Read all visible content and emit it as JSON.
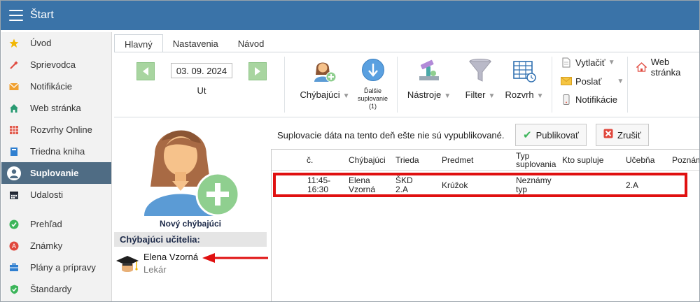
{
  "window": {
    "title": "Štart"
  },
  "sidebar": {
    "items": [
      {
        "label": "Úvod",
        "icon": "star-icon"
      },
      {
        "label": "Sprievodca",
        "icon": "wand-icon"
      },
      {
        "label": "Notifikácie",
        "icon": "envelope-icon"
      },
      {
        "label": "Web stránka",
        "icon": "home-icon"
      },
      {
        "label": "Rozvrhy Online",
        "icon": "calendar-grid-icon"
      },
      {
        "label": "Triedna kniha",
        "icon": "book-icon"
      },
      {
        "label": "Suplovanie",
        "icon": "person-icon",
        "active": true
      },
      {
        "label": "Udalosti",
        "icon": "calendar-icon"
      },
      {
        "label": "Prehľad",
        "icon": "check-circle-icon"
      },
      {
        "label": "Známky",
        "icon": "grade-icon"
      },
      {
        "label": "Plány a prípravy",
        "icon": "briefcase-icon"
      },
      {
        "label": "Štandardy",
        "icon": "shield-check-icon"
      }
    ]
  },
  "tabs": [
    {
      "label": "Hlavný",
      "active": true
    },
    {
      "label": "Nastavenia"
    },
    {
      "label": "Návod"
    }
  ],
  "ribbon": {
    "date": "03. 09. 2024",
    "day": "Ut",
    "absent_label": "Chýbajúci",
    "next_label_1": "Ďalšie",
    "next_label_2": "suplovanie",
    "next_label_3": "(1)",
    "tools_label": "Nástroje",
    "filter_label": "Filter",
    "schedule_label": "Rozvrh",
    "print_label": "Vytlačiť",
    "send_label": "Poslať",
    "notif_label": "Notifikácie",
    "web_label": "Web stránka"
  },
  "left_panel": {
    "new_absent": "Nový chýbajúci",
    "header": "Chýbajúci učitelia:",
    "teacher_name": "Elena Vzorná",
    "teacher_reason": "Lekár"
  },
  "content": {
    "notice": "Suplovacie dáta na tento deň ešte nie sú vypublikované.",
    "publish_label": "Publikovať",
    "cancel_label": "Zrušiť"
  },
  "table": {
    "columns": {
      "num": "č.",
      "absent": "Chýbajúci",
      "class": "Trieda",
      "subject": "Predmet",
      "type_1": "Typ",
      "type_2": "suplovania",
      "who": "Kto supluje",
      "room": "Učebňa",
      "note": "Poznám"
    },
    "row": {
      "time_1": "11:45-",
      "time_2": "16:30",
      "absent_1": "Elena",
      "absent_2": "Vzorná",
      "class_1": "ŠKD",
      "class_2": "2.A",
      "subject": "Krúžok",
      "type_1": "Neznámy",
      "type_2": "typ",
      "who": "",
      "room": "2.A"
    }
  },
  "colors": {
    "titlebar": "#3a73a8",
    "active_nav": "#4f6c84",
    "highlight": "#e01010"
  }
}
